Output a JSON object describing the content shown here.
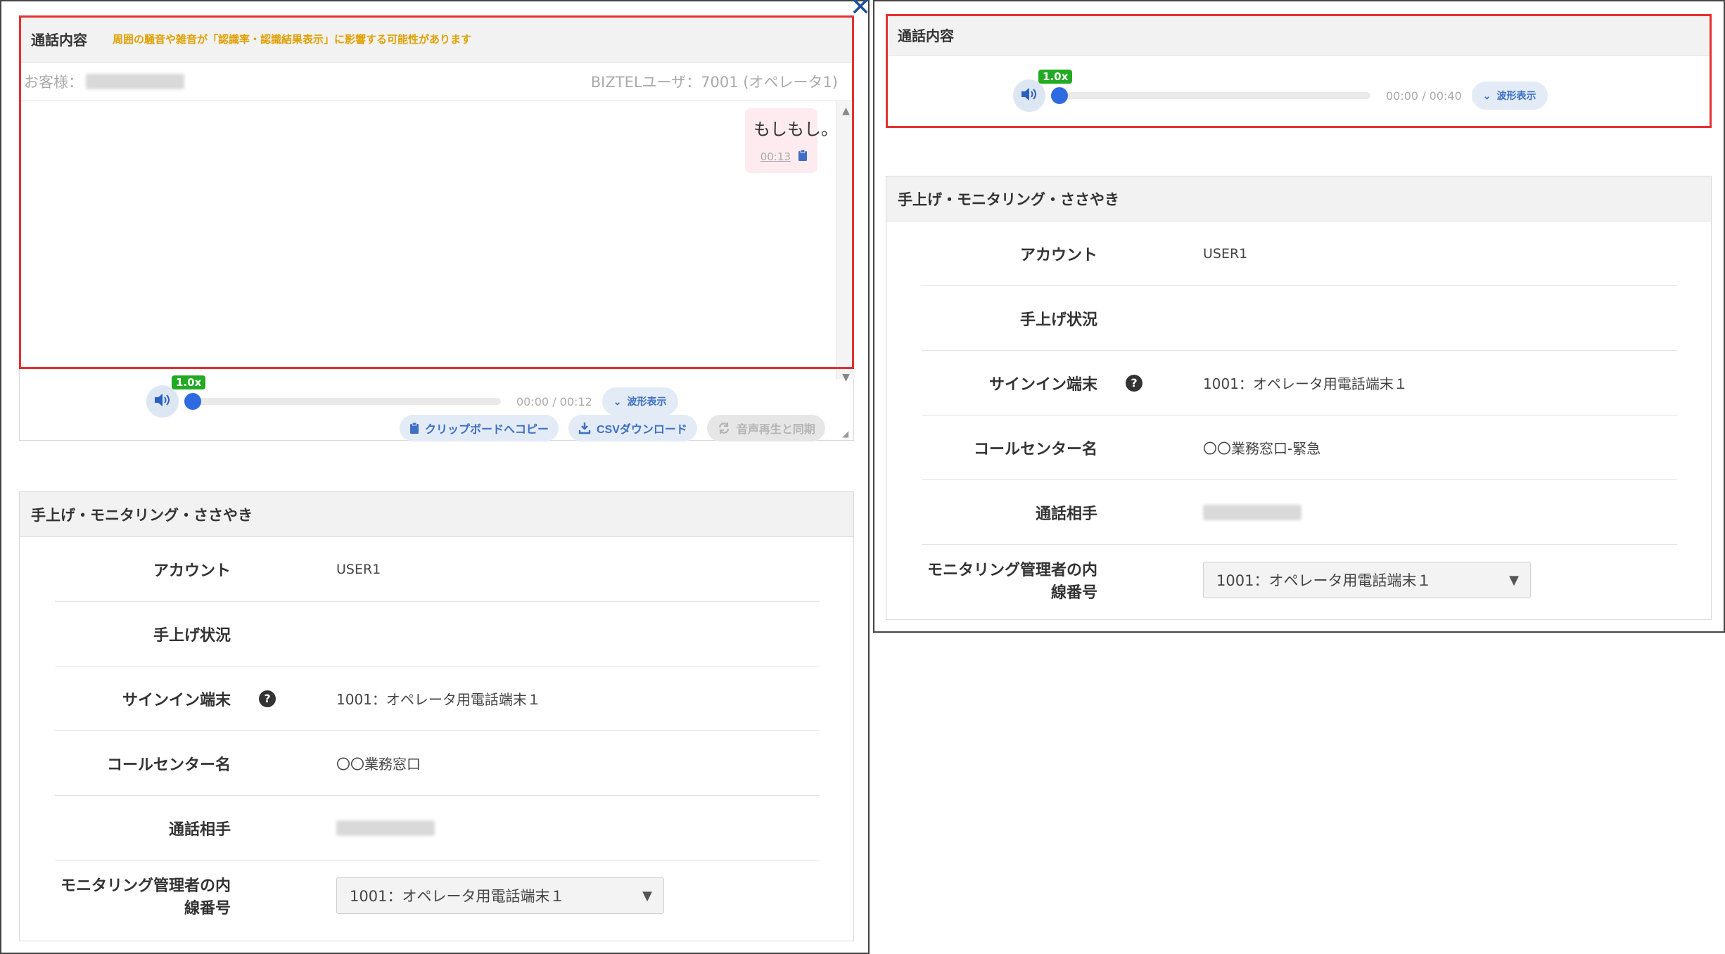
{
  "left": {
    "close_icon": "close-icon",
    "call": {
      "title": "通話内容",
      "warning": "周囲の騒音や雑音が「認識率・認識結果表示」に影響する可能性があります",
      "customer_label": "お客様：",
      "operator_label": "BIZTELユーザ：7001 (オペレータ1)",
      "bubble": {
        "text": "もしもし。",
        "time": "00:13"
      },
      "actions": {
        "clipboard": "クリップボードへコピー",
        "csv": "CSVダウンロード",
        "sync": "音声再生と同期"
      }
    },
    "player": {
      "speed": "1.0x",
      "time": "00:00 / 00:12",
      "wave": "波形表示",
      "progress": 0
    },
    "settings": {
      "title": "手上げ・モニタリング・ささやき",
      "account_label": "アカウント",
      "account_value": "USER1",
      "raise_label": "手上げ状況",
      "raise_value": "",
      "signin_label": "サインイン端末",
      "signin_value": "1001：オペレータ用電話端末１",
      "center_label": "コールセンター名",
      "center_value": "〇〇業務窓口",
      "partner_label": "通話相手",
      "ext_label": "モニタリング管理者の内線番号",
      "ext_label_line1": "モニタリング管理者の内",
      "ext_label_line2": "線番号",
      "ext_value": "1001：オペレータ用電話端末１"
    }
  },
  "right": {
    "call": {
      "title": "通話内容"
    },
    "player": {
      "speed": "1.0x",
      "time": "00:00 / 00:40",
      "wave": "波形表示",
      "progress": 0
    },
    "settings": {
      "title": "手上げ・モニタリング・ささやき",
      "account_label": "アカウント",
      "account_value": "USER1",
      "raise_label": "手上げ状況",
      "raise_value": "",
      "signin_label": "サインイン端末",
      "signin_value": "1001：オペレータ用電話端末１",
      "center_label": "コールセンター名",
      "center_value": "〇〇業務窓口-緊急",
      "partner_label": "通話相手",
      "ext_label_line1": "モニタリング管理者の内",
      "ext_label_line2": "線番号",
      "ext_value": "1001：オペレータ用電話端末１"
    }
  },
  "colors": {
    "highlight": "#e53030",
    "accent": "#2f6be0",
    "speed_badge": "#22aa22",
    "pill_bg": "#e3ebf6"
  }
}
